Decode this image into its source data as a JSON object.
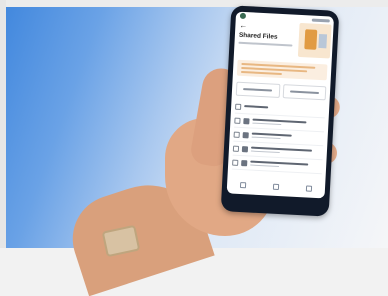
{
  "phone_screen": {
    "page_title": "Shared Files",
    "file_rows": 5
  }
}
